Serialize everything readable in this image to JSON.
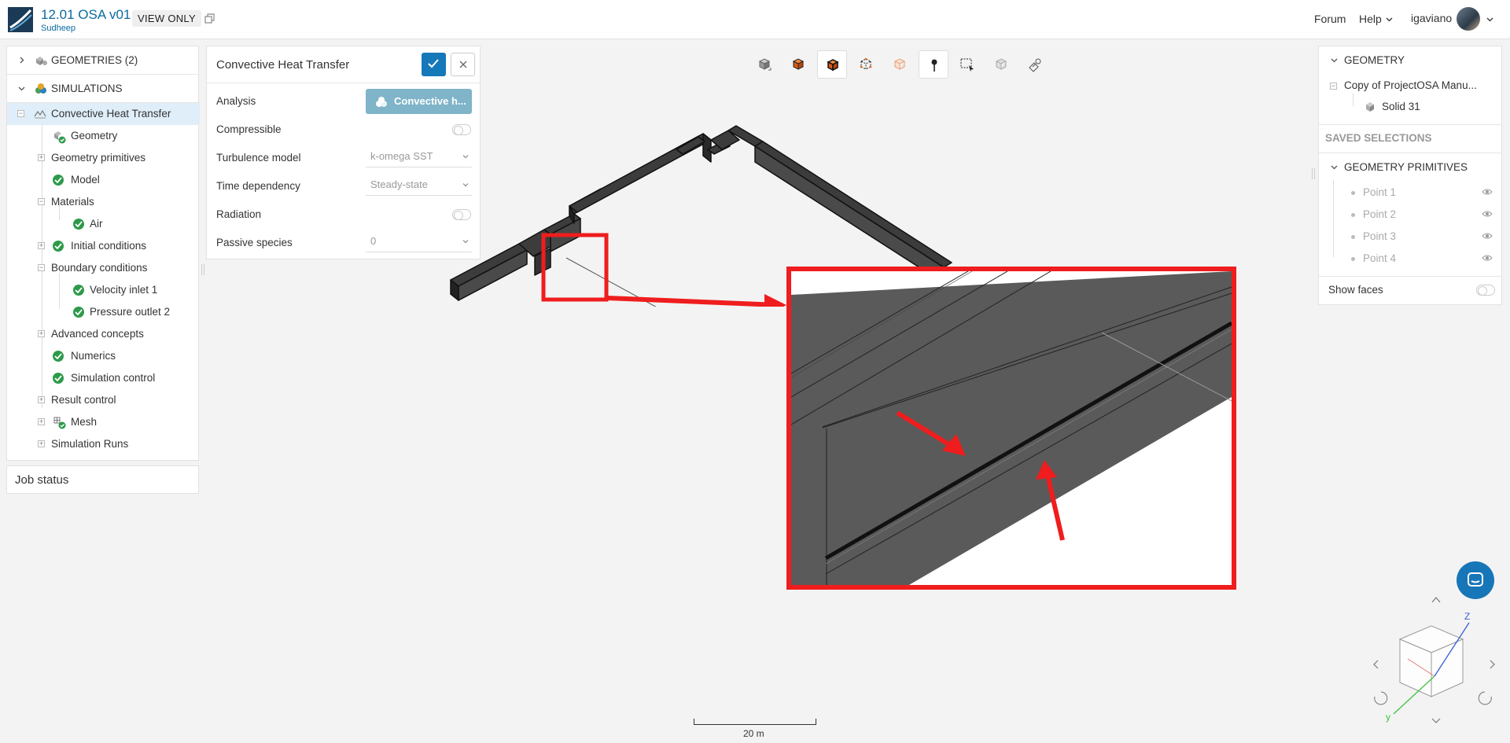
{
  "header": {
    "project_title": "12.01 OSA v01",
    "owner": "Sudheep",
    "view_only": "VIEW ONLY",
    "forum": "Forum",
    "help": "Help",
    "username": "igaviano"
  },
  "tree": {
    "geometries": "GEOMETRIES (2)",
    "simulations": "SIMULATIONS",
    "items": [
      {
        "label": "Convective Heat Transfer"
      },
      {
        "label": "Geometry"
      },
      {
        "label": "Geometry primitives"
      },
      {
        "label": "Model"
      },
      {
        "label": "Materials"
      },
      {
        "label": "Air"
      },
      {
        "label": "Initial conditions"
      },
      {
        "label": "Boundary conditions"
      },
      {
        "label": "Velocity inlet 1"
      },
      {
        "label": "Pressure outlet 2"
      },
      {
        "label": "Advanced concepts"
      },
      {
        "label": "Numerics"
      },
      {
        "label": "Simulation control"
      },
      {
        "label": "Result control"
      },
      {
        "label": "Mesh"
      },
      {
        "label": "Simulation Runs"
      }
    ],
    "job_status": "Job status"
  },
  "properties": {
    "title": "Convective Heat Transfer",
    "analysis_label": "Analysis",
    "analysis_value": "Convective h...",
    "compressible_label": "Compressible",
    "turbulence_label": "Turbulence model",
    "turbulence_value": "k-omega SST",
    "time_label": "Time dependency",
    "time_value": "Steady-state",
    "radiation_label": "Radiation",
    "passive_label": "Passive species",
    "passive_value": "0"
  },
  "right_panel": {
    "geometry": "GEOMETRY",
    "copy_name": "Copy of ProjectOSA Manu...",
    "solid": "Solid 31",
    "saved_selections": "SAVED SELECTIONS",
    "primitives": "GEOMETRY PRIMITIVES",
    "points": [
      "Point 1",
      "Point 2",
      "Point 3",
      "Point 4"
    ],
    "show_faces": "Show faces"
  },
  "scale": {
    "label": "20 m"
  },
  "colors": {
    "brand": "#0a6aa0",
    "accent": "#1578b8",
    "highlight": "#ef1d1d",
    "check": "#2d9a4a"
  }
}
